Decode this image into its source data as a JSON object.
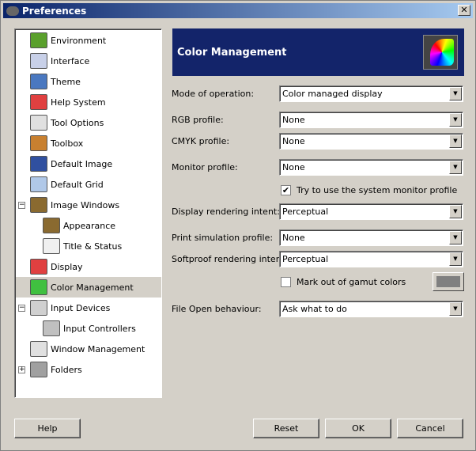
{
  "window": {
    "title": "Preferences",
    "close": "✕"
  },
  "tree": [
    {
      "label": "Environment",
      "color": "#5aa02c",
      "indent": 0
    },
    {
      "label": "Interface",
      "color": "#c8d0e8",
      "indent": 0
    },
    {
      "label": "Theme",
      "color": "#4a78c0",
      "indent": 0
    },
    {
      "label": "Help System",
      "color": "#e04040",
      "indent": 0
    },
    {
      "label": "Tool Options",
      "color": "#e0e0e0",
      "indent": 0
    },
    {
      "label": "Toolbox",
      "color": "#c88030",
      "indent": 0
    },
    {
      "label": "Default Image",
      "color": "#3050a0",
      "indent": 0
    },
    {
      "label": "Default Grid",
      "color": "#b0c8e8",
      "indent": 0
    },
    {
      "label": "Image Windows",
      "color": "#8a6a30",
      "indent": 0,
      "expander": "−"
    },
    {
      "label": "Appearance",
      "color": "#8a6a30",
      "indent": 1
    },
    {
      "label": "Title & Status",
      "color": "#f0f0f0",
      "indent": 1
    },
    {
      "label": "Display",
      "color": "#e04040",
      "indent": 0
    },
    {
      "label": "Color Management",
      "color": "#40c040",
      "indent": 0,
      "selected": true
    },
    {
      "label": "Input Devices",
      "color": "#d0d0d0",
      "indent": 0,
      "expander": "−"
    },
    {
      "label": "Input Controllers",
      "color": "#c0c0c0",
      "indent": 1
    },
    {
      "label": "Window Management",
      "color": "#e0e0e0",
      "indent": 0
    },
    {
      "label": "Folders",
      "color": "#a0a0a0",
      "indent": 0,
      "expander": "+"
    }
  ],
  "header": {
    "title": "Color Management"
  },
  "form": {
    "mode_label": "Mode of operation:",
    "mode_value": "Color managed display",
    "rgb_label": "RGB profile:",
    "rgb_value": "None",
    "cmyk_label": "CMYK profile:",
    "cmyk_value": "None",
    "monitor_label": "Monitor profile:",
    "monitor_value": "None",
    "system_monitor_label": "Try to use the system monitor profile",
    "system_monitor_checked": "✔",
    "display_intent_label": "Display rendering intent:",
    "display_intent_value": "Perceptual",
    "print_sim_label": "Print simulation profile:",
    "print_sim_value": "None",
    "softproof_label": "Softproof rendering intent:",
    "softproof_value": "Perceptual",
    "gamut_label": "Mark out of gamut colors",
    "gamut_color": "#808080",
    "file_open_label": "File Open behaviour:",
    "file_open_value": "Ask what to do"
  },
  "buttons": {
    "help": "Help",
    "reset": "Reset",
    "ok": "OK",
    "cancel": "Cancel"
  }
}
